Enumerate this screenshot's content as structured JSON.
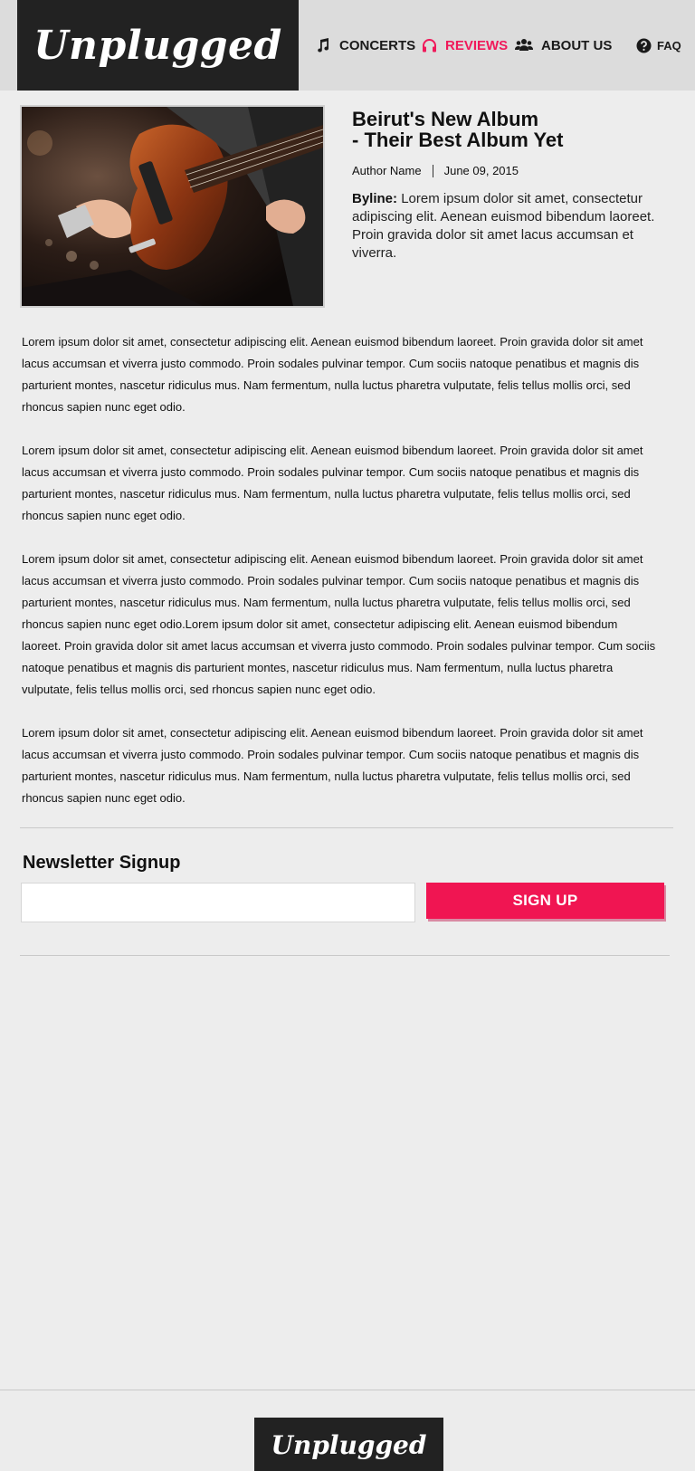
{
  "header": {
    "logo": "Unplugged",
    "nav": [
      {
        "label": "CONCERTS",
        "icon": "music-note-icon",
        "active": false
      },
      {
        "label": "REVIEWS",
        "icon": "headphones-icon",
        "active": true
      },
      {
        "label": "ABOUT US",
        "icon": "users-icon",
        "active": false
      },
      {
        "label": "FAQ",
        "icon": "question-circle-icon",
        "active": false
      }
    ]
  },
  "article": {
    "title_line1": "Beirut's New Album",
    "title_line2": "- Their Best Album Yet",
    "author": "Author Name",
    "date": "June 09, 2015",
    "byline_label": "Byline:",
    "byline_text": "Lorem ipsum dolor sit amet, consectetur adipiscing elit. Aenean euismod bibendum laoreet. Proin gravida dolor sit amet lacus accumsan et viverra.",
    "image_icon": "guitar-photo",
    "paragraphs": [
      "Lorem ipsum dolor sit amet, consectetur adipiscing elit. Aenean euismod bibendum laoreet. Proin gravida dolor sit amet lacus accumsan et viverra justo commodo. Proin sodales pulvinar tempor. Cum sociis natoque penatibus et magnis dis parturient montes, nascetur ridiculus mus. Nam fermentum, nulla luctus pharetra vulputate, felis tellus mollis orci, sed rhoncus sapien nunc eget odio.",
      "Lorem ipsum dolor sit amet, consectetur adipiscing elit. Aenean euismod bibendum laoreet. Proin gravida dolor sit amet lacus accumsan et viverra justo commodo. Proin sodales pulvinar tempor. Cum sociis natoque penatibus et magnis dis parturient montes, nascetur ridiculus mus. Nam fermentum, nulla luctus pharetra vulputate, felis tellus mollis orci, sed rhoncus sapien nunc eget odio.",
      "Lorem ipsum dolor sit amet, consectetur adipiscing elit. Aenean euismod bibendum laoreet. Proin gravida dolor sit amet lacus accumsan et viverra justo commodo. Proin sodales pulvinar tempor. Cum sociis natoque penatibus et magnis dis parturient montes, nascetur ridiculus mus. Nam fermentum, nulla luctus pharetra vulputate, felis tellus mollis orci, sed rhoncus sapien nunc eget odio.Lorem ipsum dolor sit amet, consectetur adipiscing elit. Aenean euismod bibendum laoreet. Proin gravida dolor sit amet lacus accumsan et viverra justo commodo. Proin sodales pulvinar tempor. Cum sociis natoque penatibus et magnis dis parturient montes, nascetur ridiculus mus. Nam fermentum, nulla luctus pharetra vulputate, felis tellus mollis orci, sed rhoncus sapien nunc eget odio.",
      "Lorem ipsum dolor sit amet, consectetur adipiscing elit. Aenean euismod bibendum laoreet. Proin gravida dolor sit amet lacus accumsan et viverra justo commodo. Proin sodales pulvinar tempor. Cum sociis natoque penatibus et magnis dis parturient montes, nascetur ridiculus mus. Nam fermentum, nulla luctus pharetra vulputate, felis tellus mollis orci, sed rhoncus sapien nunc eget odio."
    ]
  },
  "newsletter": {
    "title": "Newsletter Signup",
    "input_value": "",
    "button_label": "SIGN UP"
  },
  "footer": {
    "logo": "Unplugged"
  },
  "colors": {
    "accent": "#f0195a",
    "dark": "#222222",
    "background": "#ededed",
    "header_bg": "#dcdcdc"
  }
}
